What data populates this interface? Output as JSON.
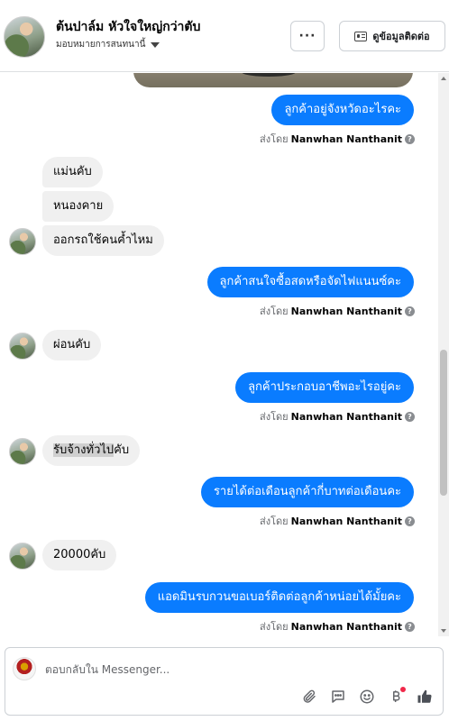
{
  "header": {
    "page_name": "ต้นปาล์ม หัวใจใหญ่กว่าตับ",
    "assign_label": "มอบหมายการสนทนานี้",
    "more_label": "···",
    "contact_label": "ดูข้อมูลติดต่อ"
  },
  "messages": {
    "m1": {
      "text": "ลูกค้าอยู่จังหวัดอะไรคะ",
      "sent_by": "ส่งโดย",
      "sender": "Nanwhan Nanthanit"
    },
    "m2": {
      "text": "แม่นคับ"
    },
    "m3": {
      "text": "หนองคาย"
    },
    "m4": {
      "text": "ออกรถใช้คนค้ำไหม"
    },
    "m5": {
      "text": "ลูกค้าสนใจซื้อสดหรือจัดไฟแนนซ์คะ",
      "sent_by": "ส่งโดย",
      "sender": "Nanwhan Nanthanit"
    },
    "m6": {
      "text": "ผ่อนคับ"
    },
    "m7": {
      "text": "ลูกค้าประกอบอาชีพอะไรอยู่คะ",
      "sent_by": "ส่งโดย",
      "sender": "Nanwhan Nanthanit"
    },
    "m8": {
      "text_highlight": "รับจ้างทั่วไป",
      "text_rest": "คับ"
    },
    "m9": {
      "text": "รายได้ต่อเดือนลูกค้ากี่บาทต่อเดือนคะ",
      "sent_by": "ส่งโดย",
      "sender": "Nanwhan Nanthanit"
    },
    "m10": {
      "text": "20000คับ"
    },
    "m11": {
      "text": "แอดมินรบกวนขอเบอร์ติดต่อลูกค้าหน่อยได้มั้ยคะ",
      "sent_by": "ส่งโดย",
      "sender": "Nanwhan Nanthanit"
    }
  },
  "composer": {
    "placeholder": "ตอบกลับใน Messenger..."
  },
  "icons": {
    "attach": "paperclip-icon",
    "saved_reply": "chat-bubble-icon",
    "emoji": "smiley-icon",
    "payment": "baht-icon",
    "like": "thumbs-up-icon"
  },
  "colors": {
    "outgoing_bubble": "#0a7cff",
    "incoming_bubble": "#f0f0f0",
    "badge": "#f02849"
  }
}
